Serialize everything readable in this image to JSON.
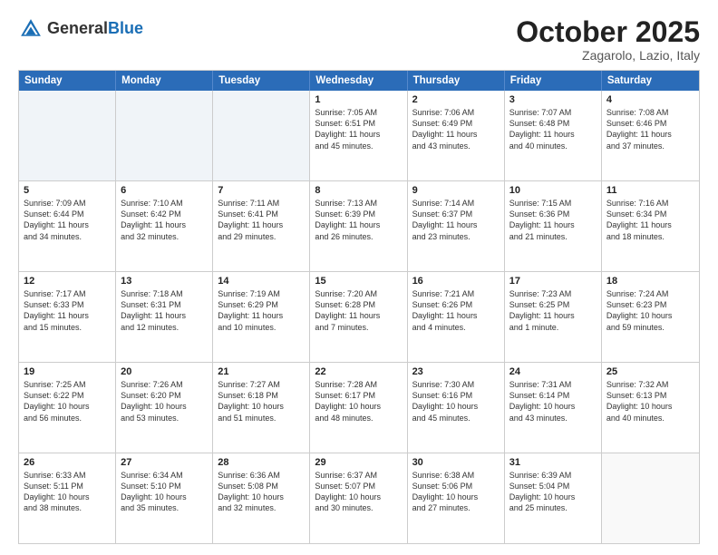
{
  "header": {
    "logo_general": "General",
    "logo_blue": "Blue",
    "month": "October 2025",
    "location": "Zagarolo, Lazio, Italy"
  },
  "weekdays": [
    "Sunday",
    "Monday",
    "Tuesday",
    "Wednesday",
    "Thursday",
    "Friday",
    "Saturday"
  ],
  "rows": [
    [
      {
        "day": "",
        "text": ""
      },
      {
        "day": "",
        "text": ""
      },
      {
        "day": "",
        "text": ""
      },
      {
        "day": "1",
        "text": "Sunrise: 7:05 AM\nSunset: 6:51 PM\nDaylight: 11 hours\nand 45 minutes."
      },
      {
        "day": "2",
        "text": "Sunrise: 7:06 AM\nSunset: 6:49 PM\nDaylight: 11 hours\nand 43 minutes."
      },
      {
        "day": "3",
        "text": "Sunrise: 7:07 AM\nSunset: 6:48 PM\nDaylight: 11 hours\nand 40 minutes."
      },
      {
        "day": "4",
        "text": "Sunrise: 7:08 AM\nSunset: 6:46 PM\nDaylight: 11 hours\nand 37 minutes."
      }
    ],
    [
      {
        "day": "5",
        "text": "Sunrise: 7:09 AM\nSunset: 6:44 PM\nDaylight: 11 hours\nand 34 minutes."
      },
      {
        "day": "6",
        "text": "Sunrise: 7:10 AM\nSunset: 6:42 PM\nDaylight: 11 hours\nand 32 minutes."
      },
      {
        "day": "7",
        "text": "Sunrise: 7:11 AM\nSunset: 6:41 PM\nDaylight: 11 hours\nand 29 minutes."
      },
      {
        "day": "8",
        "text": "Sunrise: 7:13 AM\nSunset: 6:39 PM\nDaylight: 11 hours\nand 26 minutes."
      },
      {
        "day": "9",
        "text": "Sunrise: 7:14 AM\nSunset: 6:37 PM\nDaylight: 11 hours\nand 23 minutes."
      },
      {
        "day": "10",
        "text": "Sunrise: 7:15 AM\nSunset: 6:36 PM\nDaylight: 11 hours\nand 21 minutes."
      },
      {
        "day": "11",
        "text": "Sunrise: 7:16 AM\nSunset: 6:34 PM\nDaylight: 11 hours\nand 18 minutes."
      }
    ],
    [
      {
        "day": "12",
        "text": "Sunrise: 7:17 AM\nSunset: 6:33 PM\nDaylight: 11 hours\nand 15 minutes."
      },
      {
        "day": "13",
        "text": "Sunrise: 7:18 AM\nSunset: 6:31 PM\nDaylight: 11 hours\nand 12 minutes."
      },
      {
        "day": "14",
        "text": "Sunrise: 7:19 AM\nSunset: 6:29 PM\nDaylight: 11 hours\nand 10 minutes."
      },
      {
        "day": "15",
        "text": "Sunrise: 7:20 AM\nSunset: 6:28 PM\nDaylight: 11 hours\nand 7 minutes."
      },
      {
        "day": "16",
        "text": "Sunrise: 7:21 AM\nSunset: 6:26 PM\nDaylight: 11 hours\nand 4 minutes."
      },
      {
        "day": "17",
        "text": "Sunrise: 7:23 AM\nSunset: 6:25 PM\nDaylight: 11 hours\nand 1 minute."
      },
      {
        "day": "18",
        "text": "Sunrise: 7:24 AM\nSunset: 6:23 PM\nDaylight: 10 hours\nand 59 minutes."
      }
    ],
    [
      {
        "day": "19",
        "text": "Sunrise: 7:25 AM\nSunset: 6:22 PM\nDaylight: 10 hours\nand 56 minutes."
      },
      {
        "day": "20",
        "text": "Sunrise: 7:26 AM\nSunset: 6:20 PM\nDaylight: 10 hours\nand 53 minutes."
      },
      {
        "day": "21",
        "text": "Sunrise: 7:27 AM\nSunset: 6:18 PM\nDaylight: 10 hours\nand 51 minutes."
      },
      {
        "day": "22",
        "text": "Sunrise: 7:28 AM\nSunset: 6:17 PM\nDaylight: 10 hours\nand 48 minutes."
      },
      {
        "day": "23",
        "text": "Sunrise: 7:30 AM\nSunset: 6:16 PM\nDaylight: 10 hours\nand 45 minutes."
      },
      {
        "day": "24",
        "text": "Sunrise: 7:31 AM\nSunset: 6:14 PM\nDaylight: 10 hours\nand 43 minutes."
      },
      {
        "day": "25",
        "text": "Sunrise: 7:32 AM\nSunset: 6:13 PM\nDaylight: 10 hours\nand 40 minutes."
      }
    ],
    [
      {
        "day": "26",
        "text": "Sunrise: 6:33 AM\nSunset: 5:11 PM\nDaylight: 10 hours\nand 38 minutes."
      },
      {
        "day": "27",
        "text": "Sunrise: 6:34 AM\nSunset: 5:10 PM\nDaylight: 10 hours\nand 35 minutes."
      },
      {
        "day": "28",
        "text": "Sunrise: 6:36 AM\nSunset: 5:08 PM\nDaylight: 10 hours\nand 32 minutes."
      },
      {
        "day": "29",
        "text": "Sunrise: 6:37 AM\nSunset: 5:07 PM\nDaylight: 10 hours\nand 30 minutes."
      },
      {
        "day": "30",
        "text": "Sunrise: 6:38 AM\nSunset: 5:06 PM\nDaylight: 10 hours\nand 27 minutes."
      },
      {
        "day": "31",
        "text": "Sunrise: 6:39 AM\nSunset: 5:04 PM\nDaylight: 10 hours\nand 25 minutes."
      },
      {
        "day": "",
        "text": ""
      }
    ]
  ]
}
